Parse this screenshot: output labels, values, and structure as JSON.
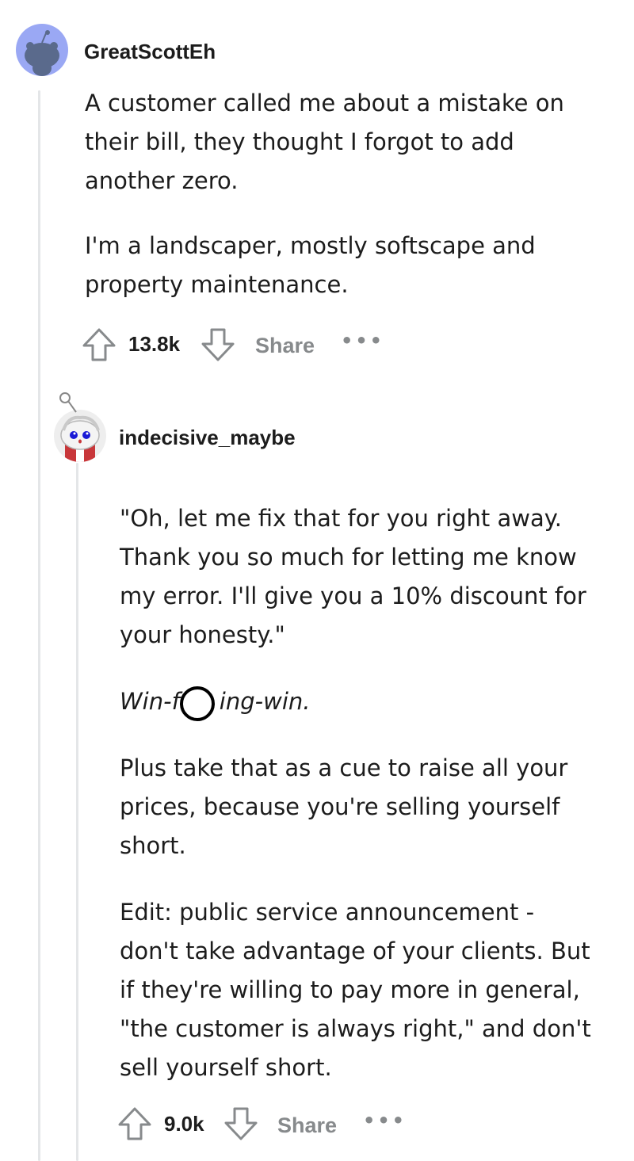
{
  "comments": [
    {
      "username": "GreatScottEh",
      "avatar_icon": "reddit-snoo-avatar-icon",
      "paragraphs": [
        "A customer called me about a mistake on their bill, they thought I forgot to add another zero.",
        "I'm a landscaper, mostly softscape and property maintenance."
      ],
      "upvote_icon": "upvote-arrow-icon",
      "vote_count": "13.8k",
      "downvote_icon": "downvote-arrow-icon",
      "share_label": "Share",
      "more_icon": "more-options-icon"
    },
    {
      "username": "indecisive_maybe",
      "avatar_icon": "custom-snoo-avatar-icon",
      "paragraph_1": "\"Oh, let me fix that for you right away. Thank you so much for letting me know my error. I'll give you a 10% discount for your honesty.\"",
      "paragraph_2_before": "Win-f",
      "paragraph_2_after": "ing-win.",
      "paragraph_3": "Plus take that as a cue to raise all your prices, because you're selling yourself short.",
      "paragraph_4": "Edit: public service announcement - don't take advantage of your clients. But if they're willing to pay more in general, \"the customer is always right,\" and don't sell yourself short.",
      "upvote_icon": "upvote-arrow-icon",
      "vote_count": "9.0k",
      "downvote_icon": "downvote-arrow-icon",
      "share_label": "Share",
      "more_icon": "more-options-icon"
    }
  ],
  "colors": {
    "thread_line": "#e4e6e8",
    "avatar_bg_1": "#9aa8f4",
    "meta_text": "#878a8c",
    "body_text": "#1c1c1c"
  },
  "cursor_icon": "cursor-ring-icon"
}
